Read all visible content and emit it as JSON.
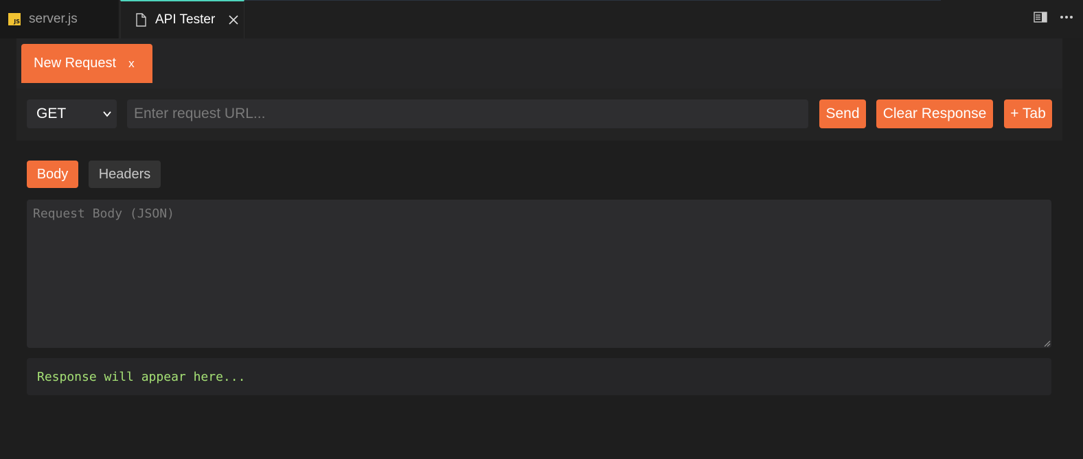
{
  "editor_tabs": {
    "inactive_tab": {
      "label": "server.js",
      "icon": "js-file-icon",
      "badge": "JS"
    },
    "active_tab": {
      "label": "API Tester",
      "icon": "file-icon",
      "close_icon": "close-icon"
    },
    "actions": [
      "split-editor-icon",
      "more-actions-icon"
    ]
  },
  "request_tabs": [
    {
      "label": "New Request",
      "close_label": "x"
    }
  ],
  "url_bar": {
    "method": "GET",
    "url_value": "",
    "url_placeholder": "Enter request URL...",
    "send_label": "Send",
    "clear_label": "Clear Response",
    "add_tab_label": "+ Tab"
  },
  "sub_tabs": {
    "body_label": "Body",
    "headers_label": "Headers",
    "active": "Body"
  },
  "request_body": {
    "value": "",
    "placeholder": "Request Body (JSON)"
  },
  "response": {
    "text": "Response will appear here..."
  },
  "colors": {
    "accent": "#f26f3a",
    "active_tab_border": "#4fd6be",
    "response_text": "#a5e075",
    "background": "#1e1e1e"
  }
}
